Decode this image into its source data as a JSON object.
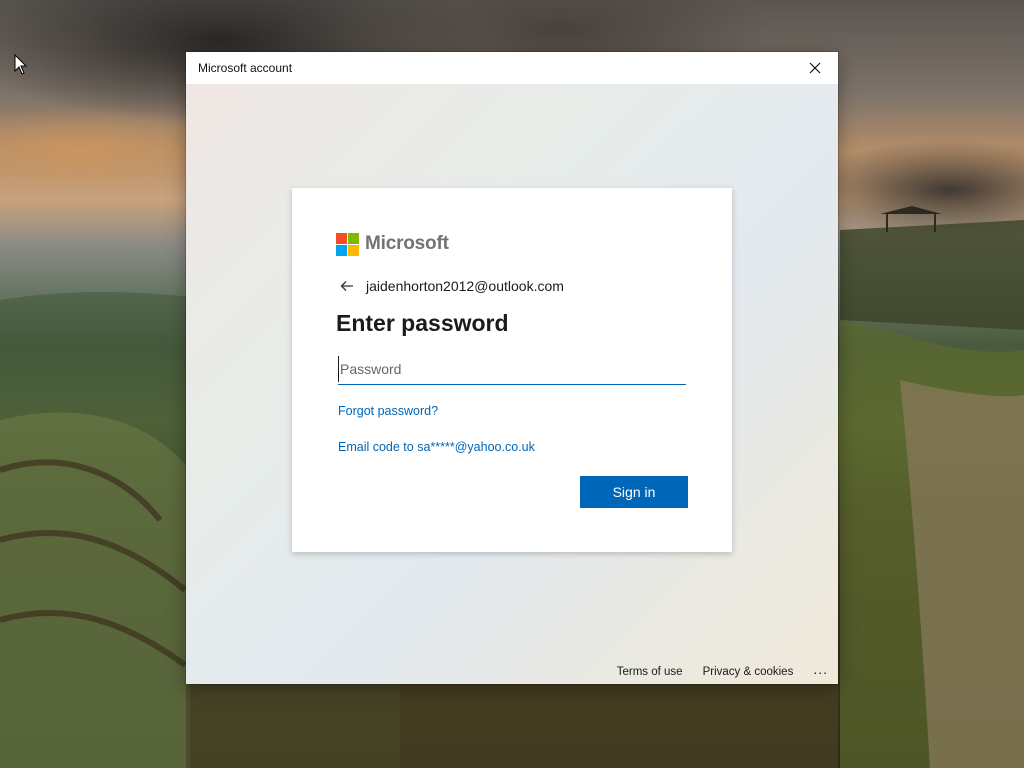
{
  "window": {
    "title": "Microsoft account"
  },
  "card": {
    "brand_name": "Microsoft",
    "identity_email": "jaidenhorton2012@outlook.com",
    "heading": "Enter password",
    "password": {
      "value": "",
      "placeholder": "Password"
    },
    "forgot_password": "Forgot password?",
    "email_code": "Email code to sa*****@yahoo.co.uk",
    "signin_label": "Sign in"
  },
  "footer": {
    "terms": "Terms of use",
    "privacy": "Privacy & cookies",
    "more": "..."
  },
  "colors": {
    "accent": "#0067b8",
    "logo_red": "#f25022",
    "logo_green": "#7fba00",
    "logo_blue": "#00a4ef",
    "logo_yellow": "#ffb900",
    "brand_gray": "#737373"
  },
  "icons": {
    "close": "close-icon",
    "back": "back-arrow-icon",
    "cursor": "mouse-cursor-icon",
    "logo": "microsoft-logo-icon"
  }
}
